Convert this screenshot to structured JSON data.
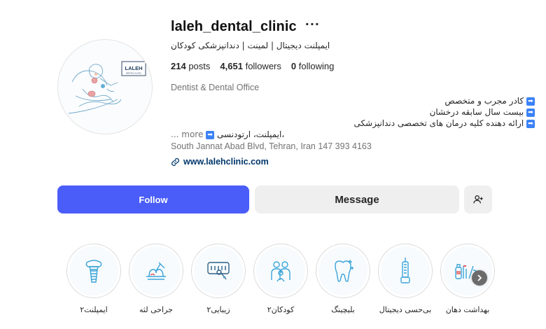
{
  "profile": {
    "username": "laleh_dental_clinic",
    "subtitle": "ایمپلنت دیجیتال | لمینت | دندانپزشکی کودکان",
    "logo_text": "LALEH",
    "stats": {
      "posts_count": "214",
      "posts_label": "posts",
      "followers_count": "4,651",
      "followers_label": "followers",
      "following_count": "0",
      "following_label": "following"
    },
    "category": "Dentist & Dental Office",
    "bio": [
      "کادر مجرب و متخصص",
      "بیست سال سابقه درخشان",
      "ارائه دهنده کلیه درمان های تخصصی دندانپزشکی",
      "ایمپلنت، ارتودنسی،"
    ],
    "bio_more": "... more",
    "address": "South Jannat Abad Blvd, Tehran, Iran 147 393 4163",
    "website": "www.lalehclinic.com"
  },
  "actions": {
    "follow_label": "Follow",
    "message_label": "Message"
  },
  "highlights": [
    {
      "label": "ایمپلنت۲",
      "icon": "implant-icon"
    },
    {
      "label": "جراحی لثه",
      "icon": "gum-surgery-icon"
    },
    {
      "label": "زیبایی۲",
      "icon": "smile-mirror-icon"
    },
    {
      "label": "کودکان۲",
      "icon": "family-icon"
    },
    {
      "label": "بلیچینگ",
      "icon": "whitening-tooth-icon"
    },
    {
      "label": "بی‌حسی دیجیتال",
      "icon": "digital-anesthesia-icon"
    },
    {
      "label": "بهداشت دهان",
      "icon": "oral-hygiene-icon"
    }
  ],
  "colors": {
    "follow_bg": "#4a5df9",
    "link": "#00376b",
    "icon_blue": "#3ba4d8"
  }
}
